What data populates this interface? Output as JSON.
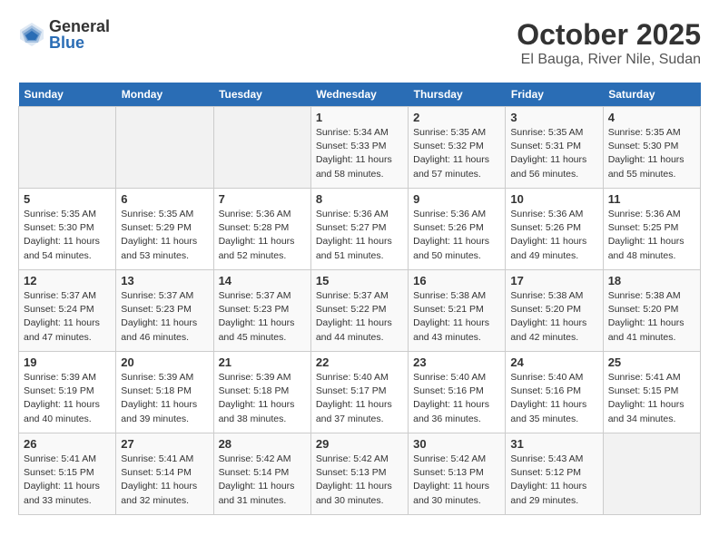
{
  "logo": {
    "general": "General",
    "blue": "Blue"
  },
  "header": {
    "month": "October 2025",
    "location": "El Bauga, River Nile, Sudan"
  },
  "days_of_week": [
    "Sunday",
    "Monday",
    "Tuesday",
    "Wednesday",
    "Thursday",
    "Friday",
    "Saturday"
  ],
  "weeks": [
    [
      {
        "day": "",
        "info": ""
      },
      {
        "day": "",
        "info": ""
      },
      {
        "day": "",
        "info": ""
      },
      {
        "day": "1",
        "info": "Sunrise: 5:34 AM\nSunset: 5:33 PM\nDaylight: 11 hours\nand 58 minutes."
      },
      {
        "day": "2",
        "info": "Sunrise: 5:35 AM\nSunset: 5:32 PM\nDaylight: 11 hours\nand 57 minutes."
      },
      {
        "day": "3",
        "info": "Sunrise: 5:35 AM\nSunset: 5:31 PM\nDaylight: 11 hours\nand 56 minutes."
      },
      {
        "day": "4",
        "info": "Sunrise: 5:35 AM\nSunset: 5:30 PM\nDaylight: 11 hours\nand 55 minutes."
      }
    ],
    [
      {
        "day": "5",
        "info": "Sunrise: 5:35 AM\nSunset: 5:30 PM\nDaylight: 11 hours\nand 54 minutes."
      },
      {
        "day": "6",
        "info": "Sunrise: 5:35 AM\nSunset: 5:29 PM\nDaylight: 11 hours\nand 53 minutes."
      },
      {
        "day": "7",
        "info": "Sunrise: 5:36 AM\nSunset: 5:28 PM\nDaylight: 11 hours\nand 52 minutes."
      },
      {
        "day": "8",
        "info": "Sunrise: 5:36 AM\nSunset: 5:27 PM\nDaylight: 11 hours\nand 51 minutes."
      },
      {
        "day": "9",
        "info": "Sunrise: 5:36 AM\nSunset: 5:26 PM\nDaylight: 11 hours\nand 50 minutes."
      },
      {
        "day": "10",
        "info": "Sunrise: 5:36 AM\nSunset: 5:26 PM\nDaylight: 11 hours\nand 49 minutes."
      },
      {
        "day": "11",
        "info": "Sunrise: 5:36 AM\nSunset: 5:25 PM\nDaylight: 11 hours\nand 48 minutes."
      }
    ],
    [
      {
        "day": "12",
        "info": "Sunrise: 5:37 AM\nSunset: 5:24 PM\nDaylight: 11 hours\nand 47 minutes."
      },
      {
        "day": "13",
        "info": "Sunrise: 5:37 AM\nSunset: 5:23 PM\nDaylight: 11 hours\nand 46 minutes."
      },
      {
        "day": "14",
        "info": "Sunrise: 5:37 AM\nSunset: 5:23 PM\nDaylight: 11 hours\nand 45 minutes."
      },
      {
        "day": "15",
        "info": "Sunrise: 5:37 AM\nSunset: 5:22 PM\nDaylight: 11 hours\nand 44 minutes."
      },
      {
        "day": "16",
        "info": "Sunrise: 5:38 AM\nSunset: 5:21 PM\nDaylight: 11 hours\nand 43 minutes."
      },
      {
        "day": "17",
        "info": "Sunrise: 5:38 AM\nSunset: 5:20 PM\nDaylight: 11 hours\nand 42 minutes."
      },
      {
        "day": "18",
        "info": "Sunrise: 5:38 AM\nSunset: 5:20 PM\nDaylight: 11 hours\nand 41 minutes."
      }
    ],
    [
      {
        "day": "19",
        "info": "Sunrise: 5:39 AM\nSunset: 5:19 PM\nDaylight: 11 hours\nand 40 minutes."
      },
      {
        "day": "20",
        "info": "Sunrise: 5:39 AM\nSunset: 5:18 PM\nDaylight: 11 hours\nand 39 minutes."
      },
      {
        "day": "21",
        "info": "Sunrise: 5:39 AM\nSunset: 5:18 PM\nDaylight: 11 hours\nand 38 minutes."
      },
      {
        "day": "22",
        "info": "Sunrise: 5:40 AM\nSunset: 5:17 PM\nDaylight: 11 hours\nand 37 minutes."
      },
      {
        "day": "23",
        "info": "Sunrise: 5:40 AM\nSunset: 5:16 PM\nDaylight: 11 hours\nand 36 minutes."
      },
      {
        "day": "24",
        "info": "Sunrise: 5:40 AM\nSunset: 5:16 PM\nDaylight: 11 hours\nand 35 minutes."
      },
      {
        "day": "25",
        "info": "Sunrise: 5:41 AM\nSunset: 5:15 PM\nDaylight: 11 hours\nand 34 minutes."
      }
    ],
    [
      {
        "day": "26",
        "info": "Sunrise: 5:41 AM\nSunset: 5:15 PM\nDaylight: 11 hours\nand 33 minutes."
      },
      {
        "day": "27",
        "info": "Sunrise: 5:41 AM\nSunset: 5:14 PM\nDaylight: 11 hours\nand 32 minutes."
      },
      {
        "day": "28",
        "info": "Sunrise: 5:42 AM\nSunset: 5:14 PM\nDaylight: 11 hours\nand 31 minutes."
      },
      {
        "day": "29",
        "info": "Sunrise: 5:42 AM\nSunset: 5:13 PM\nDaylight: 11 hours\nand 30 minutes."
      },
      {
        "day": "30",
        "info": "Sunrise: 5:42 AM\nSunset: 5:13 PM\nDaylight: 11 hours\nand 30 minutes."
      },
      {
        "day": "31",
        "info": "Sunrise: 5:43 AM\nSunset: 5:12 PM\nDaylight: 11 hours\nand 29 minutes."
      },
      {
        "day": "",
        "info": ""
      }
    ]
  ]
}
